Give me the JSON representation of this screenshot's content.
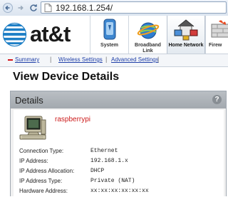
{
  "browser": {
    "url": "192.168.1.254/"
  },
  "header": {
    "brand": "at&t",
    "tabs": [
      {
        "label": "System",
        "icon": "system-icon"
      },
      {
        "label": "Broadband Link",
        "icon": "broadband-icon"
      },
      {
        "label": "Home Network",
        "icon": "home-network-icon",
        "active": true
      },
      {
        "label": "Firew",
        "icon": "firewall-icon"
      }
    ]
  },
  "subnav": {
    "items": [
      "Summary",
      "Wireless Settings",
      "Advanced Settings"
    ]
  },
  "page": {
    "title": "View Device Details"
  },
  "details": {
    "title": "Details",
    "help_label": "?",
    "device_name": "raspberrypi",
    "rows": [
      {
        "label": "Connection Type:",
        "value": "Ethernet"
      },
      {
        "label": "IP Address:",
        "value": "192.168.1.x"
      },
      {
        "label": "IP Address Allocation:",
        "value": "DHCP"
      },
      {
        "label": "IP Address Type:",
        "value": "Private (NAT)"
      },
      {
        "label": "Hardware Address:",
        "value": "xx:xx:xx:xx:xx:xx"
      }
    ]
  },
  "colors": {
    "link": "#1f3fa8",
    "device_name": "#cc1b1b",
    "att_blue": "#1e7fc6",
    "panel_header": "#a9afb5"
  }
}
